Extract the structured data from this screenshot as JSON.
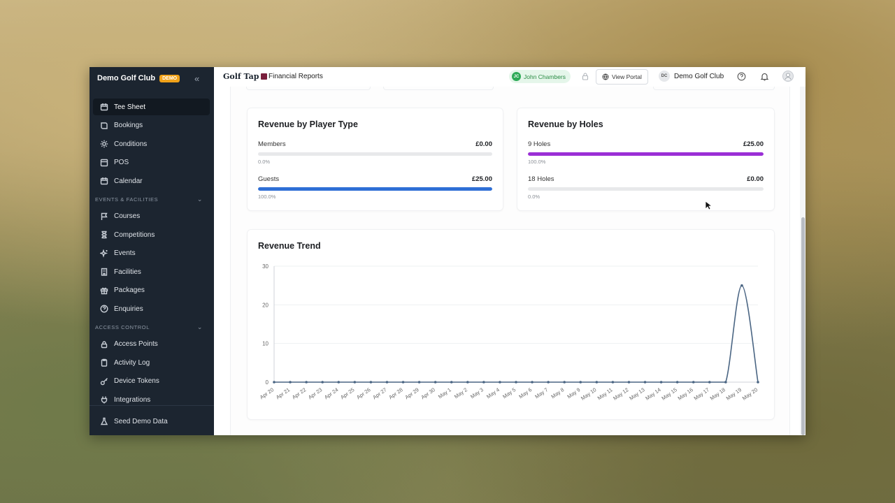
{
  "sidebar": {
    "club_name": "Demo Golf Club",
    "badge": "DEMO",
    "items_top": [
      {
        "label": "Tee Sheet",
        "icon": "calendar-icon",
        "active": true
      },
      {
        "label": "Bookings",
        "icon": "book-icon"
      },
      {
        "label": "Conditions",
        "icon": "sun-icon"
      },
      {
        "label": "POS",
        "icon": "card-icon"
      },
      {
        "label": "Calendar",
        "icon": "calendar-icon"
      }
    ],
    "section_events": "EVENTS & FACILITIES",
    "items_events": [
      {
        "label": "Courses",
        "icon": "flag-icon"
      },
      {
        "label": "Competitions",
        "icon": "hourglass-icon"
      },
      {
        "label": "Events",
        "icon": "sparkles-icon"
      },
      {
        "label": "Facilities",
        "icon": "building-icon"
      },
      {
        "label": "Packages",
        "icon": "gift-icon"
      },
      {
        "label": "Enquiries",
        "icon": "help-circle-icon"
      }
    ],
    "section_access": "ACCESS CONTROL",
    "items_access": [
      {
        "label": "Access Points",
        "icon": "lock-icon"
      },
      {
        "label": "Activity Log",
        "icon": "clipboard-icon"
      },
      {
        "label": "Device Tokens",
        "icon": "key-icon"
      },
      {
        "label": "Integrations",
        "icon": "plug-icon"
      }
    ],
    "bottom_item": {
      "label": "Seed Demo Data",
      "icon": "flask-icon"
    }
  },
  "topbar": {
    "logo_text": "Golf Tap",
    "page_title": "Financial Reports",
    "user_initials": "JC",
    "user_name": "John Chambers",
    "view_portal": "View Portal",
    "club_initials": "DC",
    "club_name": "Demo Golf Club"
  },
  "player_type": {
    "title": "Revenue by Player Type",
    "rows": [
      {
        "label": "Members",
        "amount": "£0.00",
        "percent": "0.0%",
        "fraction": 0.0,
        "color": "#2f6fd6"
      },
      {
        "label": "Guests",
        "amount": "£25.00",
        "percent": "100.0%",
        "fraction": 1.0,
        "color": "#2f6fd6"
      }
    ]
  },
  "holes": {
    "title": "Revenue by Holes",
    "rows": [
      {
        "label": "9 Holes",
        "amount": "£25.00",
        "percent": "100.0%",
        "fraction": 1.0,
        "color": "#9b2fd6"
      },
      {
        "label": "18 Holes",
        "amount": "£0.00",
        "percent": "0.0%",
        "fraction": 0.0,
        "color": "#9b2fd6"
      }
    ]
  },
  "trend": {
    "title": "Revenue Trend"
  },
  "chart_data": {
    "type": "line",
    "title": "Revenue Trend",
    "x": [
      "Apr 20",
      "Apr 21",
      "Apr 22",
      "Apr 23",
      "Apr 24",
      "Apr 25",
      "Apr 26",
      "Apr 27",
      "Apr 28",
      "Apr 29",
      "Apr 30",
      "May 1",
      "May 2",
      "May 3",
      "May 4",
      "May 5",
      "May 6",
      "May 7",
      "May 8",
      "May 9",
      "May 10",
      "May 11",
      "May 12",
      "May 13",
      "May 14",
      "May 15",
      "May 16",
      "May 17",
      "May 18",
      "May 19",
      "May 20"
    ],
    "series": [
      {
        "values": [
          0,
          0,
          0,
          0,
          0,
          0,
          0,
          0,
          0,
          0,
          0,
          0,
          0,
          0,
          0,
          0,
          0,
          0,
          0,
          0,
          0,
          0,
          0,
          0,
          0,
          0,
          0,
          0,
          0,
          25,
          0
        ],
        "color": "#4a6583"
      }
    ],
    "ylim": [
      0,
      30
    ],
    "yticks": [
      0,
      10,
      20,
      30
    ],
    "grid": true
  }
}
